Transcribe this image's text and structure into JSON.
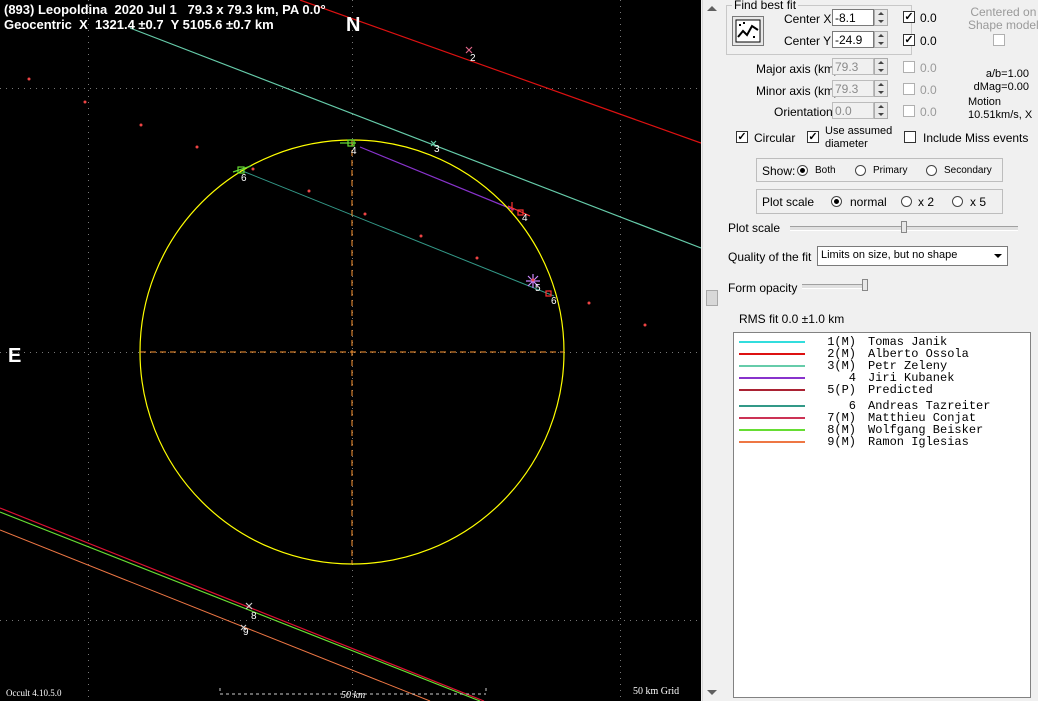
{
  "plot": {
    "title_line1": "(893) Leopoldina  2020 Jul 1   79.3 x 79.3 km, PA 0.0°",
    "title_line2": "Geocentric  X  1321.4 ±0.7  Y 5105.6 ±0.7 km",
    "north_label": "N",
    "east_label": "E",
    "version": "Occult 4.10.5.0",
    "scale_label": "50 km",
    "grid_label": "50 km Grid",
    "chord_labels": [
      "2",
      "3",
      "4",
      "4",
      "5",
      "6",
      "6",
      "8",
      "9"
    ],
    "colors": {
      "background": "#000000",
      "ellipse": "#ffff00",
      "axes": "#ff9933"
    }
  },
  "panel": {
    "find_best_fit": "Find best fit",
    "centered_on_shape": "Centered on\nShape model",
    "center_x": {
      "label": "Center X",
      "value": "-8.1",
      "fixed_value": "0.0"
    },
    "center_y": {
      "label": "Center Y",
      "value": "-24.9",
      "fixed_value": "0.0"
    },
    "major_axis": {
      "label": "Major axis (km)",
      "value": "79.3",
      "fixed_value": "0.0"
    },
    "minor_axis": {
      "label": "Minor axis (km)",
      "value": "79.3",
      "fixed_value": "0.0"
    },
    "orientation": {
      "label": "Orientation",
      "value": "0.0",
      "fixed_value": "0.0"
    },
    "ab_ratio": "a/b=1.00",
    "dmag": "dMag=0.00",
    "motion_label": "Motion",
    "motion_value": "10.51km/s, X",
    "circular": "Circular",
    "use_assumed": "Use assumed\ndiameter",
    "include_miss": "Include Miss events",
    "show": {
      "label": "Show:",
      "options": [
        "Both",
        "Primary",
        "Secondary"
      ],
      "selected": "Both"
    },
    "plot_scale_group": {
      "label": "Plot scale",
      "options": [
        "normal",
        "x 2",
        "x 5"
      ],
      "selected": "normal"
    },
    "plot_scale_slider_label": "Plot scale",
    "quality_label": "Quality of the fit",
    "quality_value": "Limits on size, but no shape",
    "form_opacity_label": "Form opacity",
    "rms": "RMS fit 0.0 ±1.0 km",
    "legend": [
      {
        "num": "1(M)",
        "name": "Tomas Janik",
        "color": "#33dddd"
      },
      {
        "num": "2(M)",
        "name": "Alberto Ossola",
        "color": "#dd1111"
      },
      {
        "num": "3(M)",
        "name": "Petr Zeleny",
        "color": "#66ccaa"
      },
      {
        "num": "4",
        "name": "Jiri Kubanek",
        "color": "#8833cc"
      },
      {
        "num": "5(P)",
        "name": "Predicted",
        "color": "#aa2233"
      },
      {
        "num": "6",
        "name": "Andreas Tazreiter",
        "color": "#339988"
      },
      {
        "num": "7(M)",
        "name": "Matthieu Conjat",
        "color": "#cc3355"
      },
      {
        "num": "8(M)",
        "name": "Wolfgang Beisker",
        "color": "#66dd33"
      },
      {
        "num": "9(M)",
        "name": "Ramon Iglesias",
        "color": "#ee7744"
      }
    ]
  }
}
